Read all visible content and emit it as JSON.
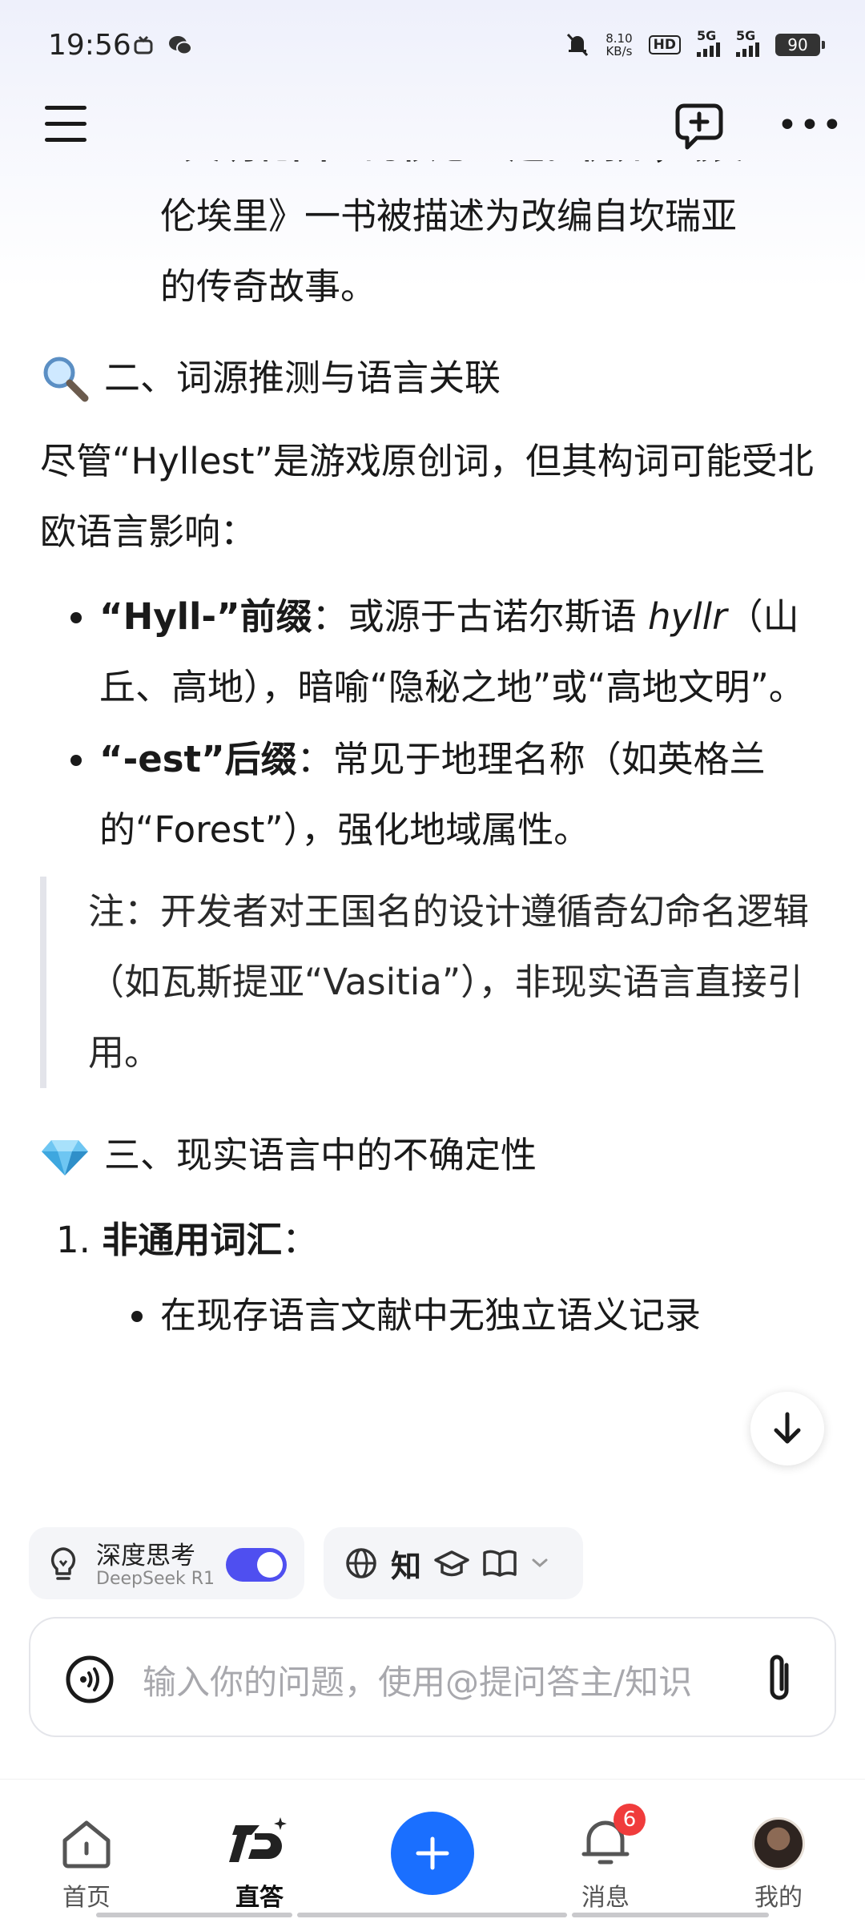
{
  "status_bar": {
    "time": "19:56",
    "net_speed_value": "8.10",
    "net_speed_unit": "KB/s",
    "hd_label": "HD",
    "signal_1": "5G",
    "signal_2": "5G",
    "battery": "90"
  },
  "content": {
    "intro_lines": [
      "“文明轮回” 的核心主题。例如，《裴",
      "伦埃里》一书被描述为改编自坎瑞亚",
      "的传奇故事。"
    ],
    "section2_title": "二、词源推测与语言关联",
    "section2_intro": "尽管“Hyllest”是游戏原创词，但其构词可能受北欧语言影响：",
    "bullets": [
      {
        "bold": "“Hyll-”前缀",
        "text_a": "：或源于古诺尔斯语 ",
        "italic": "hyllr",
        "text_b": "（山丘、高地），暗喻“隐秘之地”或“高地文明”。"
      },
      {
        "bold": "“-est”后缀",
        "text_a": "：常见于地理名称（如英格兰的“Forest”），强化地域属性。"
      }
    ],
    "note": "注：开发者对王国名的设计遵循奇幻命名逻辑（如瓦斯提亚“Vasitia”），非现实语言直接引用。",
    "section3_title": "三、现实语言中的不确定性",
    "ol_item": {
      "number": "1.",
      "bold": "非通用词汇",
      "suffix": "："
    },
    "sub_bullet": "在现存语言文献中无独立语义记录"
  },
  "input_panel": {
    "deep_think_title": "深度思考",
    "deep_think_model": "DeepSeek R1",
    "deep_think_enabled": true,
    "tool_zhi": "知",
    "placeholder": "输入你的问题，使用@提问答主/知识"
  },
  "tab_bar": {
    "tabs": [
      {
        "label": "首页",
        "icon": "home-icon"
      },
      {
        "label": "直答",
        "icon": "zhida-logo-icon",
        "active": true
      },
      {
        "label": "",
        "icon": "plus-icon"
      },
      {
        "label": "消息",
        "icon": "message-bell-icon",
        "badge": "6"
      },
      {
        "label": "我的",
        "icon": "avatar"
      }
    ]
  },
  "colors": {
    "accent_blue": "#1a6fff",
    "toggle_on": "#4f4ff0",
    "badge_red": "#f03c3c"
  }
}
